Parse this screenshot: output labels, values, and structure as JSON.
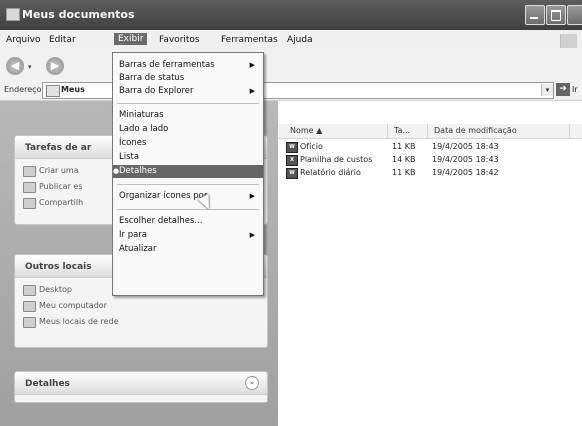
{
  "window": {
    "title": "Meus documentos"
  },
  "menubar": {
    "items": [
      "Arquivo",
      "Editar",
      "Exibir",
      "Favoritos",
      "Ferramentas",
      "Ajuda"
    ]
  },
  "toolbar": {
    "back": "◀",
    "forward": "▶",
    "drop": "▾"
  },
  "address": {
    "label": "Endereço",
    "value": "Meus",
    "go": "Ir"
  },
  "view_menu": {
    "items": [
      {
        "label": "Barras de ferramentas",
        "submenu": true
      },
      {
        "label": "Barra de status",
        "submenu": false
      },
      {
        "label": "Barra do Explorer",
        "submenu": true
      },
      {
        "label": "Miniaturas",
        "submenu": false
      },
      {
        "label": "Lado a lado",
        "submenu": false
      },
      {
        "label": "Ícones",
        "submenu": false
      },
      {
        "label": "Lista",
        "submenu": false
      },
      {
        "label": "Detalhes",
        "submenu": false,
        "selected": true
      },
      {
        "label": "Organizar ícones por",
        "submenu": true
      },
      {
        "label": "Escolher detalhes...",
        "submenu": false
      },
      {
        "label": "Ir para",
        "submenu": true
      },
      {
        "label": "Atualizar",
        "submenu": false
      }
    ]
  },
  "tasks_panel": {
    "title": "Tarefas de ar",
    "links": [
      "Criar uma",
      "Publicar es",
      "Compartilh"
    ]
  },
  "other_places_panel": {
    "title": "Outros locais",
    "links": [
      "Desktop",
      "Meu computador",
      "Meus locais de rede"
    ]
  },
  "details_panel": {
    "title": "Detalhes",
    "toggle": "»"
  },
  "files": {
    "columns": [
      "Nome",
      "Ta...",
      "Data de modificação"
    ],
    "rows": [
      {
        "name": "Ofício",
        "size": "11 KB",
        "date": "19/4/2005 18:43"
      },
      {
        "name": "Planilha de custos",
        "size": "14 KB",
        "date": "19/4/2005 18:43"
      },
      {
        "name": "Relatório diário",
        "size": "11 KB",
        "date": "19/4/2005 18:42"
      }
    ]
  }
}
